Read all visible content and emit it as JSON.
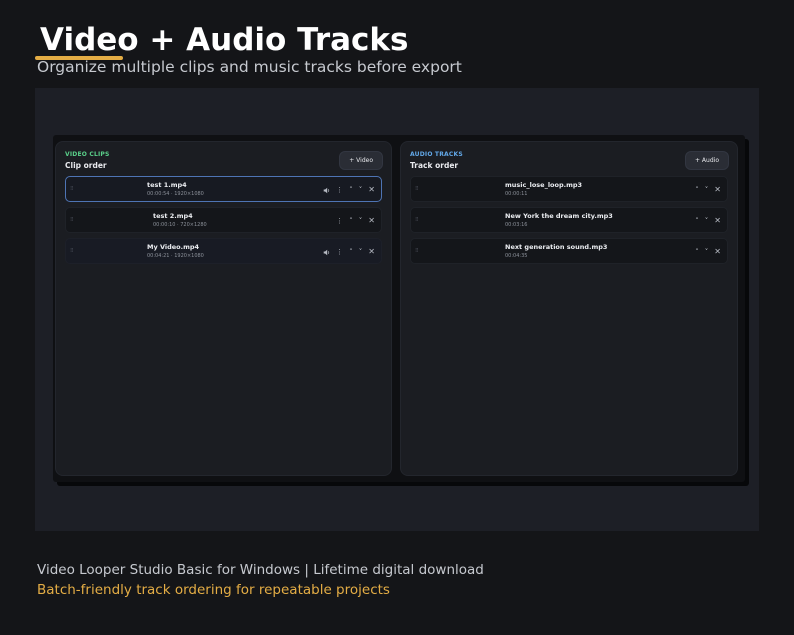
{
  "hero": {
    "title": "Video + Audio Tracks",
    "subtitle": "Organize multiple clips and music tracks before export"
  },
  "video_panel": {
    "eyebrow": "VIDEO CLIPS",
    "title": "Clip order",
    "add_label": "+ Video",
    "clips": [
      {
        "name": "test 1.mp4",
        "meta": "00:00:54 · 1920×1080",
        "has_audio": true,
        "selected": true
      },
      {
        "name": "test 2.mp4",
        "meta": "00:00:10 · 720×1280",
        "has_audio": false,
        "selected": false
      },
      {
        "name": "My Video.mp4",
        "meta": "00:04:21 · 1920×1080",
        "has_audio": true,
        "selected": false
      }
    ]
  },
  "audio_panel": {
    "eyebrow": "AUDIO TRACKS",
    "title": "Track order",
    "add_label": "+ Audio",
    "tracks": [
      {
        "name": "music_lose_loop.mp3",
        "meta": "00:00:11"
      },
      {
        "name": "New York the dream city.mp3",
        "meta": "00:03:16"
      },
      {
        "name": "Next generation sound.mp3",
        "meta": "00:04:35"
      }
    ]
  },
  "icons": {
    "grip": "drag-handle-icon",
    "speaker": "speaker-icon",
    "more": "more-vertical-icon",
    "up": "chevron-up-icon",
    "down": "chevron-down-icon",
    "remove": "close-icon"
  },
  "footer": {
    "line1": "Video Looper Studio Basic for Windows  |  Lifetime digital download",
    "line2": "Batch-friendly track ordering for repeatable projects"
  },
  "colors": {
    "accent_gold": "#e4ad45",
    "video_label": "#5ad08a",
    "audio_label": "#62a8e8",
    "selected_border": "#4e74b4"
  }
}
